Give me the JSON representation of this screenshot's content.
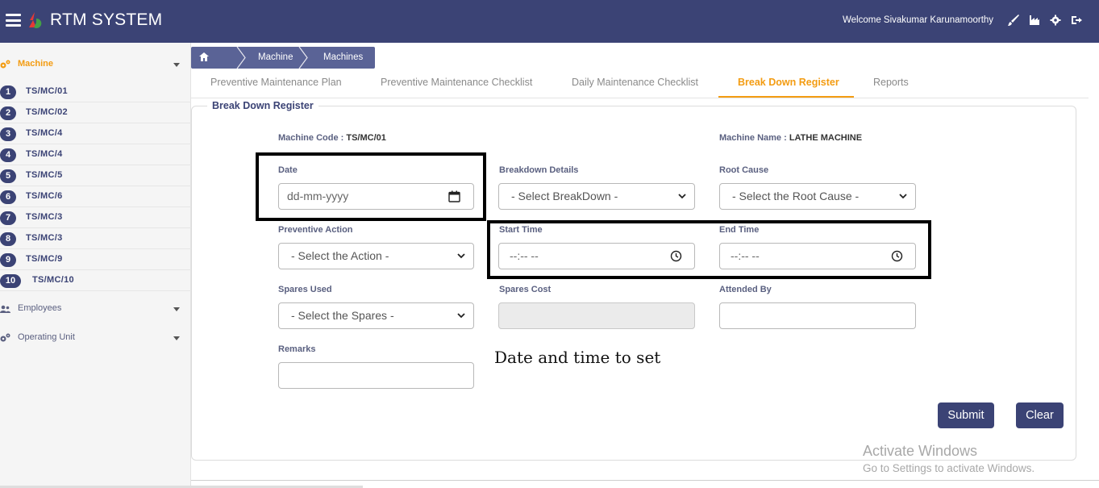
{
  "app": {
    "title": "RTM SYSTEM",
    "welcome": "Welcome Sivakumar Karunamoorthy"
  },
  "colors": {
    "primary": "#3b4375",
    "accent": "#f39c12"
  },
  "sidebar": {
    "machine_label": "Machine",
    "items": [
      {
        "num": "1",
        "code": "TS/MC/01"
      },
      {
        "num": "2",
        "code": "TS/MC/02"
      },
      {
        "num": "3",
        "code": "TS/MC/4"
      },
      {
        "num": "4",
        "code": "TS/MC/4"
      },
      {
        "num": "5",
        "code": "TS/MC/5"
      },
      {
        "num": "6",
        "code": "TS/MC/6"
      },
      {
        "num": "7",
        "code": "TS/MC/3"
      },
      {
        "num": "8",
        "code": "TS/MC/3"
      },
      {
        "num": "9",
        "code": "TS/MC/9"
      },
      {
        "num": "10",
        "code": "TS/MC/10"
      }
    ],
    "employees_label": "Employees",
    "operating_label": "Operating Unit"
  },
  "breadcrumb": {
    "home": "Home",
    "machine": "Machine",
    "machines": "Machines"
  },
  "tabs": [
    "Preventive Maintenance Plan",
    "Preventive Maintenance Checklist",
    "Daily Maintenance Checklist",
    "Break Down Register",
    "Reports"
  ],
  "form": {
    "legend": "Break Down Register",
    "machine_code_label": "Machine Code :",
    "machine_code": "TS/MC/01",
    "machine_name_label": "Machine Name :",
    "machine_name": "LATHE MACHINE",
    "date_label": "Date",
    "date_placeholder": "dd-mm-yyyy",
    "breakdown_label": "Breakdown Details",
    "breakdown_value": "- Select BreakDown -",
    "root_cause_label": "Root Cause",
    "root_cause_value": "- Select the Root Cause -",
    "preventive_label": "Preventive Action",
    "preventive_value": "- Select the Action -",
    "start_time_label": "Start Time",
    "start_time_placeholder": "--:-- --",
    "end_time_label": "End Time",
    "end_time_placeholder": "--:-- --",
    "spares_used_label": "Spares Used",
    "spares_used_value": "- Select the Spares -",
    "spares_cost_label": "Spares Cost",
    "attended_by_label": "Attended By",
    "remarks_label": "Remarks",
    "submit": "Submit",
    "clear": "Clear"
  },
  "annotation": "Date and time to set",
  "watermark": {
    "line1": "Activate Windows",
    "line2": "Go to Settings to activate Windows."
  },
  "icons": [
    "menu-icon",
    "logo-icon",
    "brush-icon",
    "factory-icon",
    "gear-icon",
    "logout-icon",
    "home-icon",
    "calendar-icon",
    "clock-icon",
    "chevron-down-icon"
  ]
}
